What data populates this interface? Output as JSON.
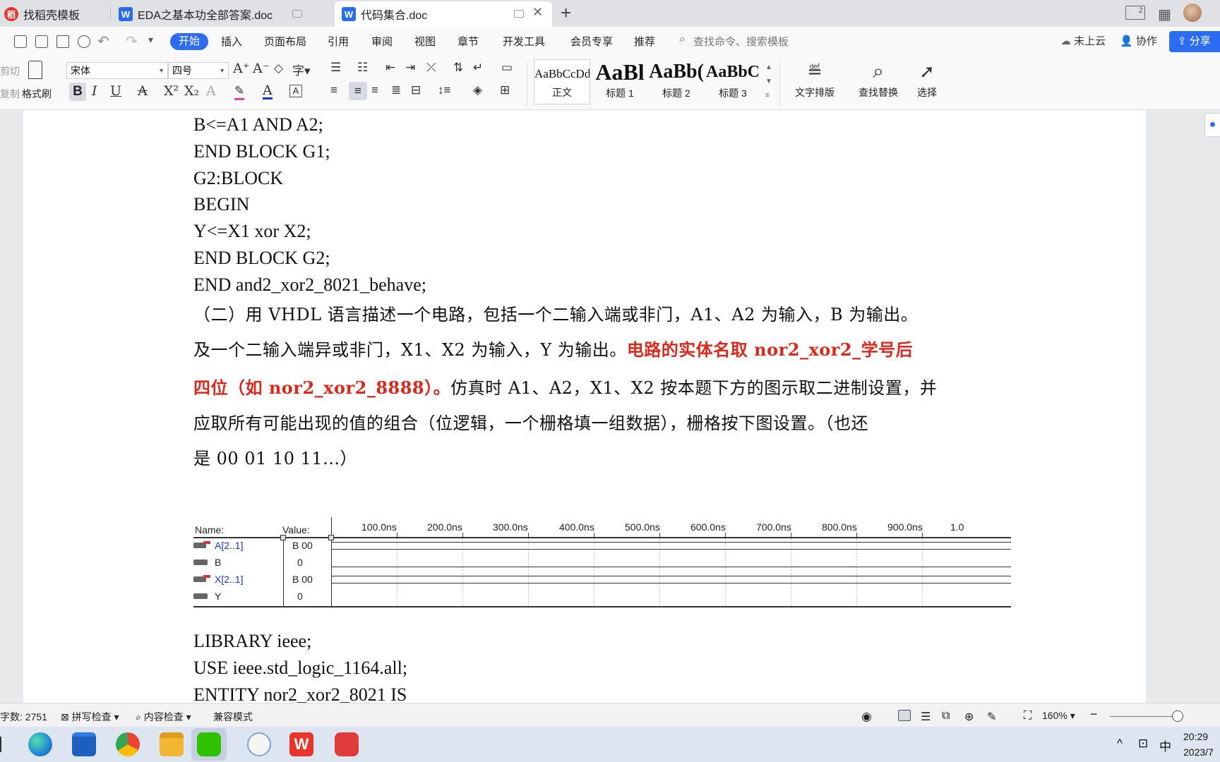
{
  "tabs": [
    {
      "label": "找稻壳模板",
      "icon": "docer-icon"
    },
    {
      "label": "EDA之基本功全部答案.doc",
      "icon": "wps-doc-icon"
    },
    {
      "label": "代码集合.doc",
      "icon": "wps-doc-icon",
      "active": true
    }
  ],
  "menu": {
    "start": "开始",
    "items": [
      "插入",
      "页面布局",
      "引用",
      "审阅",
      "视图",
      "章节",
      "开发工具",
      "会员专享",
      "推荐"
    ],
    "search_placeholder": "查找命令、搜索模板",
    "cloud": "未上云",
    "collab": "协作",
    "share": "分享"
  },
  "toolbar": {
    "cut": "剪切",
    "copy": "复制",
    "format_painter": "格式刷",
    "font": "宋体",
    "size": "四号",
    "styles": [
      {
        "sample": "AaBbCcDd",
        "name": "正文"
      },
      {
        "sample": "AaBl",
        "name": "标题 1"
      },
      {
        "sample": "AaBb(",
        "name": "标题 2"
      },
      {
        "sample": "AaBbC",
        "name": "标题 3"
      }
    ],
    "text_layout": "文字排版",
    "find_replace": "查找替换",
    "select": "选择"
  },
  "doc": {
    "code_top": [
      "B<=A1 AND A2;",
      "END BLOCK G1;",
      "G2:BLOCK",
      "BEGIN",
      "Y<=X1 xor X2;",
      "END BLOCK G2;",
      "END and2_xor2_8021_behave;"
    ],
    "para1": "（二）用 VHDL 语言描述一个电路，包括一个二输入端或非门，A1、A2 为输入，B 为输出。",
    "para2_black": "及一个二输入端异或非门，X1、X2 为输入，Y 为输出。",
    "para2_red": "电路的实体名取 nor2_xor2_学号后",
    "para3_red": "四位（如 nor2_xor2_8888）。",
    "para3_black": "仿真时 A1、A2，X1、X2 按本题下方的图示取二进制设置，并",
    "para4": "应取所有可能出现的值的组合（位逻辑，一个栅格填一组数据），栅格按下图设置。（也还",
    "para5": "是 00 01 10 11...）",
    "code_bottom": [
      "LIBRARY ieee;",
      "USE ieee.std_logic_1164.all;",
      "ENTITY nor2_xor2_8021 IS"
    ]
  },
  "waveform": {
    "name_header": "Name:",
    "value_header": "Value:",
    "time_labels": [
      "100.0ns",
      "200.0ns",
      "300.0ns",
      "400.0ns",
      "500.0ns",
      "600.0ns",
      "700.0ns",
      "800.0ns",
      "900.0ns",
      "1.0"
    ],
    "signals": [
      {
        "name": "A[2..1]",
        "value": "B 00",
        "bus": true
      },
      {
        "name": "B",
        "value": "0",
        "bus": false
      },
      {
        "name": "X[2..1]",
        "value": "B 00",
        "bus": true
      },
      {
        "name": "Y",
        "value": "0",
        "bus": false
      }
    ]
  },
  "status": {
    "word_count": "字数: 2751",
    "spell_check": "拼写检查",
    "content_check": "内容检查",
    "compat_mode": "兼容模式",
    "zoom": "160%"
  },
  "taskbar": {
    "ime": "中",
    "time": "20:29",
    "date": "2023/7"
  }
}
